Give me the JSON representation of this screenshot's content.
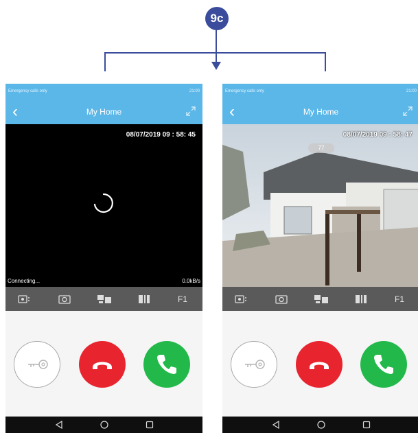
{
  "badge": "9c",
  "phones": [
    {
      "status_left": "Emergency calls only",
      "status_right": "21:00",
      "title": "My Home",
      "timestamp": "08/07/2019  09 : 58: 45",
      "connecting": "Connecting...",
      "rate": "0.0kB/s",
      "f1": "F1"
    },
    {
      "status_left": "Emergency calls only",
      "status_right": "21:00",
      "title": "My Home",
      "timestamp": "08/07/2019  09 : 58: 47",
      "pill": "77",
      "f1": "F1"
    }
  ],
  "icons": [
    "back-icon",
    "expand-icon",
    "record-icon",
    "camera-icon",
    "intercom-icon",
    "unlock-icon",
    "key-icon",
    "hangup-icon",
    "phone-icon",
    "nav-back-icon",
    "nav-home-icon",
    "nav-recents-icon"
  ],
  "colors": {
    "header": "#5bb7e8",
    "badge": "#3a4c9b",
    "hangup": "#e8242f",
    "answer": "#22b94a",
    "toolbar": "#5a5a5a"
  }
}
